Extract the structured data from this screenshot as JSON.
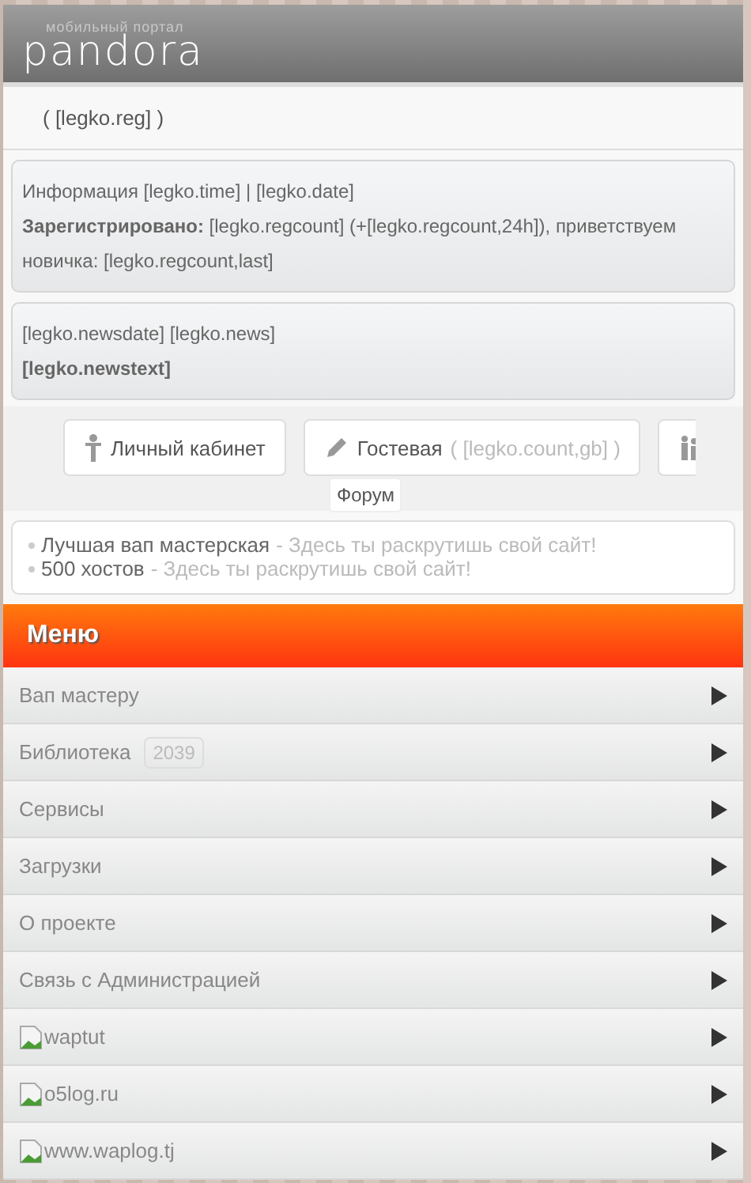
{
  "header": {
    "tagline": "мобильный портал",
    "logo": "pandora"
  },
  "reg_line": "( [legko.reg] )",
  "info_card": {
    "lines": [
      "Информация [legko.time] | [legko.date]",
      "**Зарегистрировано:** [legko.regcount] (+[legko.regcount,24h]), приветствуем новичка: [legko.regcount,last]"
    ]
  },
  "news_card": {
    "title": "[legko.newsdate] [legko.news]",
    "text": "[legko.newstext]"
  },
  "nav_buttons": [
    {
      "kind": "person",
      "label": "Личный кабинет"
    },
    {
      "kind": "pencil",
      "label": "Гостевая",
      "count": "( [legko.count,gb] )"
    },
    {
      "kind": "people"
    }
  ],
  "popup": {
    "label": "Форум"
  },
  "ads": [
    {
      "link": "Лучшая вап мастерская",
      "text": "- Здесь ты раскрутишь свой сайт!"
    },
    {
      "link": "500 хостов",
      "text": "- Здесь ты раскрутишь свой сайт!"
    }
  ],
  "menu": {
    "title": "Меню",
    "items": [
      {
        "kind": "text",
        "label": "Вап мастеру"
      },
      {
        "kind": "badge",
        "label": "Библиотека",
        "badge": "2039"
      },
      {
        "kind": "text",
        "label": "Сервисы"
      },
      {
        "kind": "text",
        "label": "Загрузки"
      },
      {
        "kind": "text",
        "label": "О проекте"
      },
      {
        "kind": "text",
        "label": "Связь с Администрацией"
      },
      {
        "kind": "image",
        "label": "waptut"
      },
      {
        "kind": "image",
        "label": "o5log.ru"
      },
      {
        "kind": "image",
        "label": "www.waplog.tj"
      }
    ]
  }
}
